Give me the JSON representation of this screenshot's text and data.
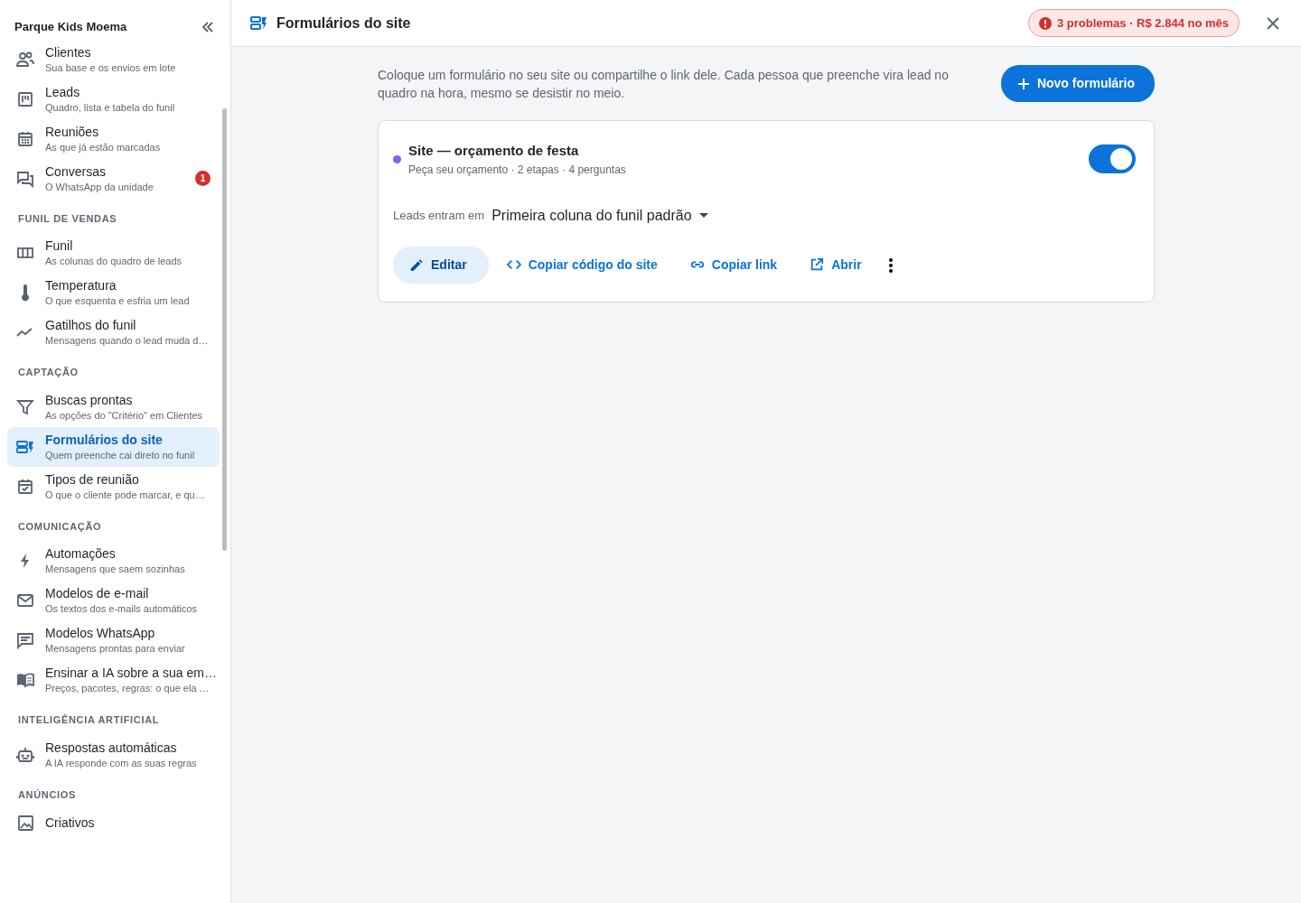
{
  "sidebar": {
    "workspace": "Parque Kids Moema",
    "groups": [
      {
        "items": [
          {
            "label": "Clientes",
            "hint": "Sua base e os envios em lote",
            "selected": false
          },
          {
            "label": "Leads",
            "hint": "Quadro, lista e tabela do funil",
            "selected": false
          },
          {
            "label": "Reuniões",
            "hint": "As que já estão marcadas",
            "selected": false
          },
          {
            "label": "Conversas",
            "hint": "O WhatsApp da unidade",
            "selected": false,
            "badge": "1"
          }
        ]
      },
      {
        "title": "FUNIL DE VENDAS",
        "items": [
          {
            "label": "Funil",
            "hint": "As colunas do quadro de leads",
            "selected": false
          },
          {
            "label": "Temperatura",
            "hint": "O que esquenta e esfria um lead",
            "selected": false
          },
          {
            "label": "Gatilhos do funil",
            "hint": "Mensagens quando o lead muda d…",
            "selected": false
          }
        ]
      },
      {
        "title": "CAPTAÇÃO",
        "items": [
          {
            "label": "Buscas prontas",
            "hint": "As opções do \"Critério\" em Clientes",
            "selected": false
          },
          {
            "label": "Formulários do site",
            "hint": "Quem preenche cai direto no funil",
            "selected": true
          },
          {
            "label": "Tipos de reunião",
            "hint": "O que o cliente pode marcar, e qu…",
            "selected": false
          }
        ]
      },
      {
        "title": "COMUNICAÇÃO",
        "items": [
          {
            "label": "Automações",
            "hint": "Mensagens que saem sozinhas",
            "selected": false
          },
          {
            "label": "Modelos de e-mail",
            "hint": "Os textos dos e-mails automáticos",
            "selected": false
          },
          {
            "label": "Modelos WhatsApp",
            "hint": "Mensagens prontas para enviar",
            "selected": false
          },
          {
            "label": "Ensinar a IA sobre a sua em…",
            "hint": "Preços, pacotes, regras: o que ela …",
            "selected": false
          }
        ]
      },
      {
        "title": "INTELIGÊNCIA ARTIFICIAL",
        "items": [
          {
            "label": "Respostas automáticas",
            "hint": "A IA responde com as suas regras",
            "selected": false
          }
        ]
      },
      {
        "title": "ANÚNCIOS",
        "items": [
          {
            "label": "Criativos",
            "selected": false
          }
        ]
      }
    ]
  },
  "header": {
    "title": "Formulários do site",
    "alert": "3 problemas · R$ 2.844 no mês"
  },
  "intro": "Coloque um formulário no seu site ou compartilhe o link dele. Cada pessoa que preenche vira lead no quadro na hora, mesmo se desistir no meio.",
  "new_button": "Novo formulário",
  "forms": [
    {
      "name": "Site — orçamento de festa",
      "color": "#8b5cf6",
      "details": "Peça seu orçamento · 2 etapas · 4 perguntas",
      "on": true,
      "destination_label": "Leads entram em",
      "destination": "Primeira coluna do funil padrão",
      "actions": [
        {
          "kind": "edit",
          "label": "Editar"
        },
        {
          "kind": "code",
          "label": "Copiar código do site"
        },
        {
          "kind": "link",
          "label": "Copiar link"
        },
        {
          "kind": "open",
          "label": "Abrir"
        }
      ]
    }
  ]
}
